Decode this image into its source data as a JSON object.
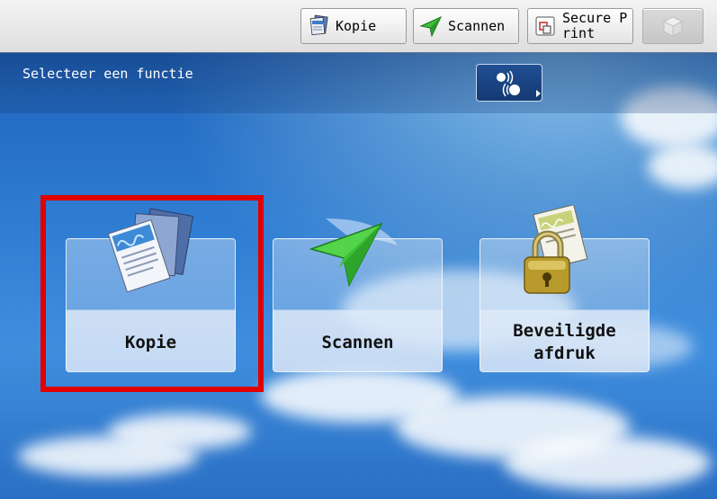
{
  "topbar": {
    "buttons": [
      {
        "label": "Kopie",
        "icon": "copy-icon"
      },
      {
        "label": "Scannen",
        "icon": "scan-icon"
      },
      {
        "label": "Secure P\nrint",
        "icon": "secure-print-icon"
      },
      {
        "label": "",
        "icon": "box-icon",
        "disabled": true
      }
    ]
  },
  "header": {
    "title": "Selecteer een functie"
  },
  "functions": [
    {
      "label": "Kopie",
      "icon": "copy-documents-icon",
      "selected": true
    },
    {
      "label": "Scannen",
      "icon": "paper-plane-icon"
    },
    {
      "label": "Beveiligde\nafdruk",
      "icon": "padlock-document-icon"
    }
  ],
  "colors": {
    "highlight": "#e00000",
    "sky": "#2f7dd3"
  }
}
